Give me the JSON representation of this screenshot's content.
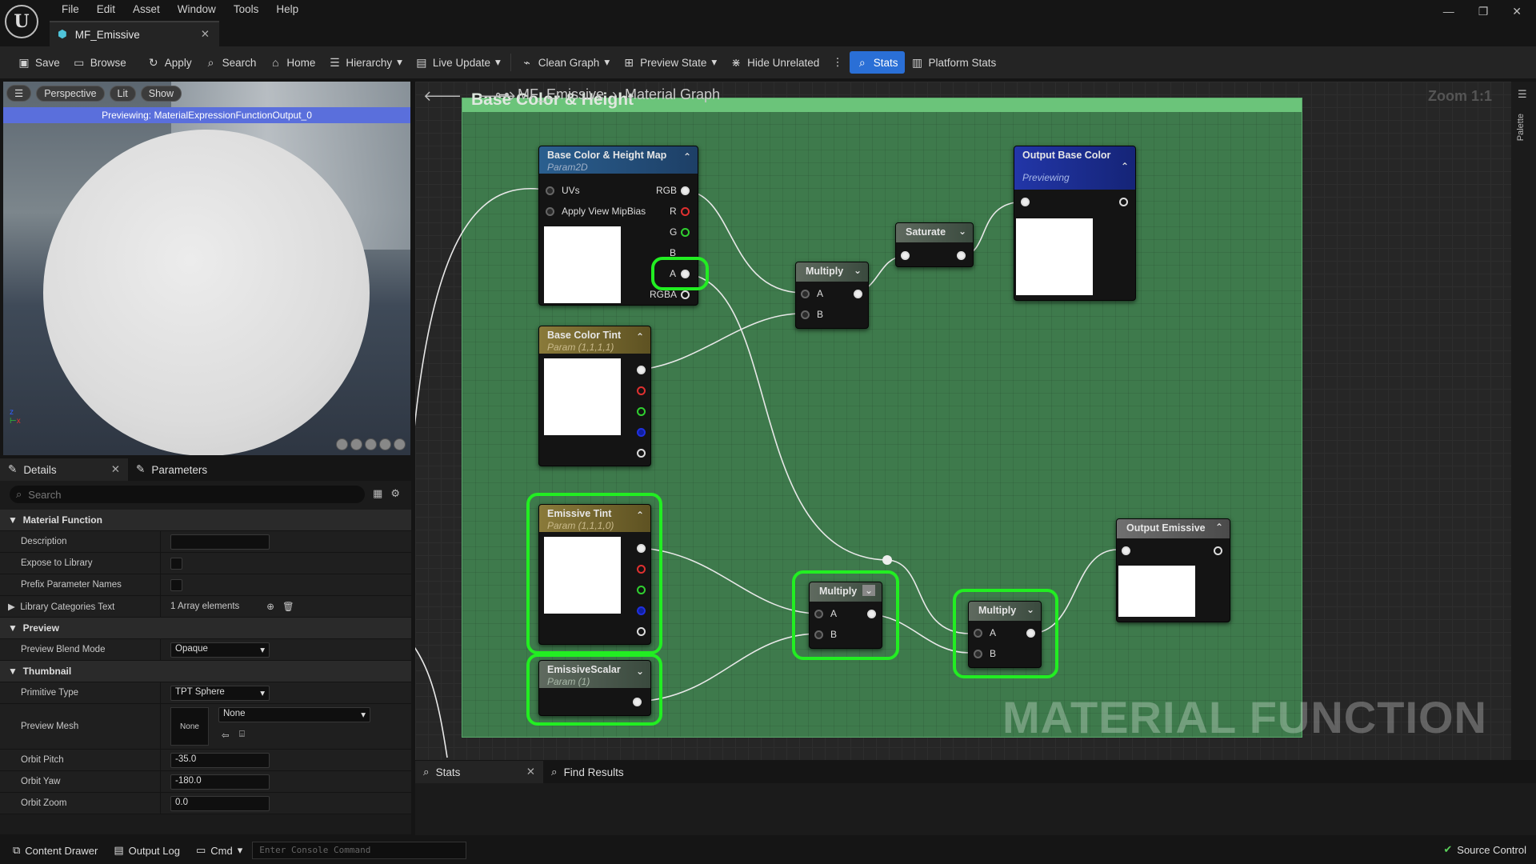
{
  "app": {
    "logo_text": "U",
    "menu": [
      "File",
      "Edit",
      "Asset",
      "Window",
      "Tools",
      "Help"
    ],
    "doc_tab": "MF_Emissive"
  },
  "toolbar": {
    "save": "Save",
    "browse": "Browse",
    "apply": "Apply",
    "search": "Search",
    "home": "Home",
    "hierarchy": "Hierarchy",
    "live_update": "Live Update",
    "clean_graph": "Clean Graph",
    "preview_state": "Preview State",
    "hide_unrelated": "Hide Unrelated",
    "stats": "Stats",
    "platform_stats": "Platform Stats"
  },
  "viewport": {
    "perspective": "Perspective",
    "lit": "Lit",
    "show": "Show",
    "previewing": "Previewing: MaterialExpressionFunctionOutput_0"
  },
  "details": {
    "tab_details": "Details",
    "tab_parameters": "Parameters",
    "search_placeholder": "Search",
    "sections": {
      "material_function": "Material Function",
      "preview": "Preview",
      "thumbnail": "Thumbnail"
    },
    "description_label": "Description",
    "expose_label": "Expose to Library",
    "prefix_label": "Prefix Parameter Names",
    "library_label": "Library Categories Text",
    "library_value": "1 Array elements",
    "blend_label": "Preview Blend Mode",
    "blend_value": "Opaque",
    "primitive_label": "Primitive Type",
    "primitive_value": "TPT Sphere",
    "mesh_label": "Preview Mesh",
    "mesh_thumb": "None",
    "mesh_value": "None",
    "pitch_label": "Orbit Pitch",
    "pitch_value": "-35.0",
    "yaw_label": "Orbit Yaw",
    "yaw_value": "-180.0",
    "zoom_label": "Orbit Zoom",
    "zoom_value": "0.0"
  },
  "graph": {
    "crumb1": "MF_Emissive",
    "crumb2": "Material Graph",
    "zoom": "Zoom 1:1",
    "comment": "Base Color & Height",
    "watermark": "MATERIAL FUNCTION",
    "palette": "Palette",
    "nodes": {
      "bcmap": {
        "title": "Base Color & Height Map",
        "sub": "Param2D",
        "uvs": "UVs",
        "mip": "Apply View MipBias",
        "rgb": "RGB",
        "r": "R",
        "g": "G",
        "b": "B",
        "a": "A",
        "rgba": "RGBA"
      },
      "bctint": {
        "title": "Base Color Tint",
        "sub": "Param (1,1,1,1)"
      },
      "etint": {
        "title": "Emissive Tint",
        "sub": "Param (1,1,1,0)"
      },
      "escalar": {
        "title": "EmissiveScalar",
        "sub": "Param (1)"
      },
      "mul1": {
        "title": "Multiply",
        "a": "A",
        "b": "B"
      },
      "sat": {
        "title": "Saturate"
      },
      "outbase": {
        "title": "Output Base Color",
        "sub": "Previewing"
      },
      "mul2": {
        "title": "Multiply",
        "a": "A",
        "b": "B"
      },
      "mul3": {
        "title": "Multiply",
        "a": "A",
        "b": "B"
      },
      "outemis": {
        "title": "Output Emissive"
      }
    }
  },
  "stats": {
    "tab_stats": "Stats",
    "tab_find": "Find Results"
  },
  "bottom": {
    "content_drawer": "Content Drawer",
    "output_log": "Output Log",
    "cmd": "Cmd",
    "console_placeholder": "Enter Console Command",
    "source_control": "Source Control"
  }
}
